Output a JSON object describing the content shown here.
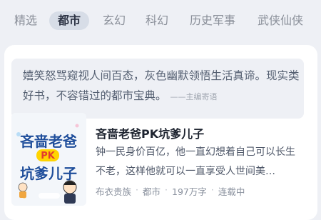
{
  "tabs": [
    {
      "label": "精选",
      "active": false
    },
    {
      "label": "都市",
      "active": true
    },
    {
      "label": "玄幻",
      "active": false
    },
    {
      "label": "科幻",
      "active": false
    },
    {
      "label": "历史军事",
      "active": false
    },
    {
      "label": "武侠仙侠",
      "active": false
    }
  ],
  "editor_quote": {
    "text": "嬉笑怒骂窥视人间百态，灰色幽默领悟生活真谛。现实类好书，不容错过的都市宝典。",
    "signature": "——主编寄语"
  },
  "book": {
    "title": "吝啬老爸PK坑爹儿子",
    "description": "钟一民身价百亿，他一直幻想着自己可以长生不老，这样他就可以一直享受人世间美…",
    "author": "布衣贵族",
    "category": "都市",
    "word_count": "197万字",
    "status": "连载中",
    "cover_text": [
      "吝啬老爸",
      "PK",
      "坑爹儿子"
    ]
  },
  "colors": {
    "background": "#eef0f5",
    "active_tab_bg": "#d7dde7",
    "accent": "#1e2430"
  }
}
